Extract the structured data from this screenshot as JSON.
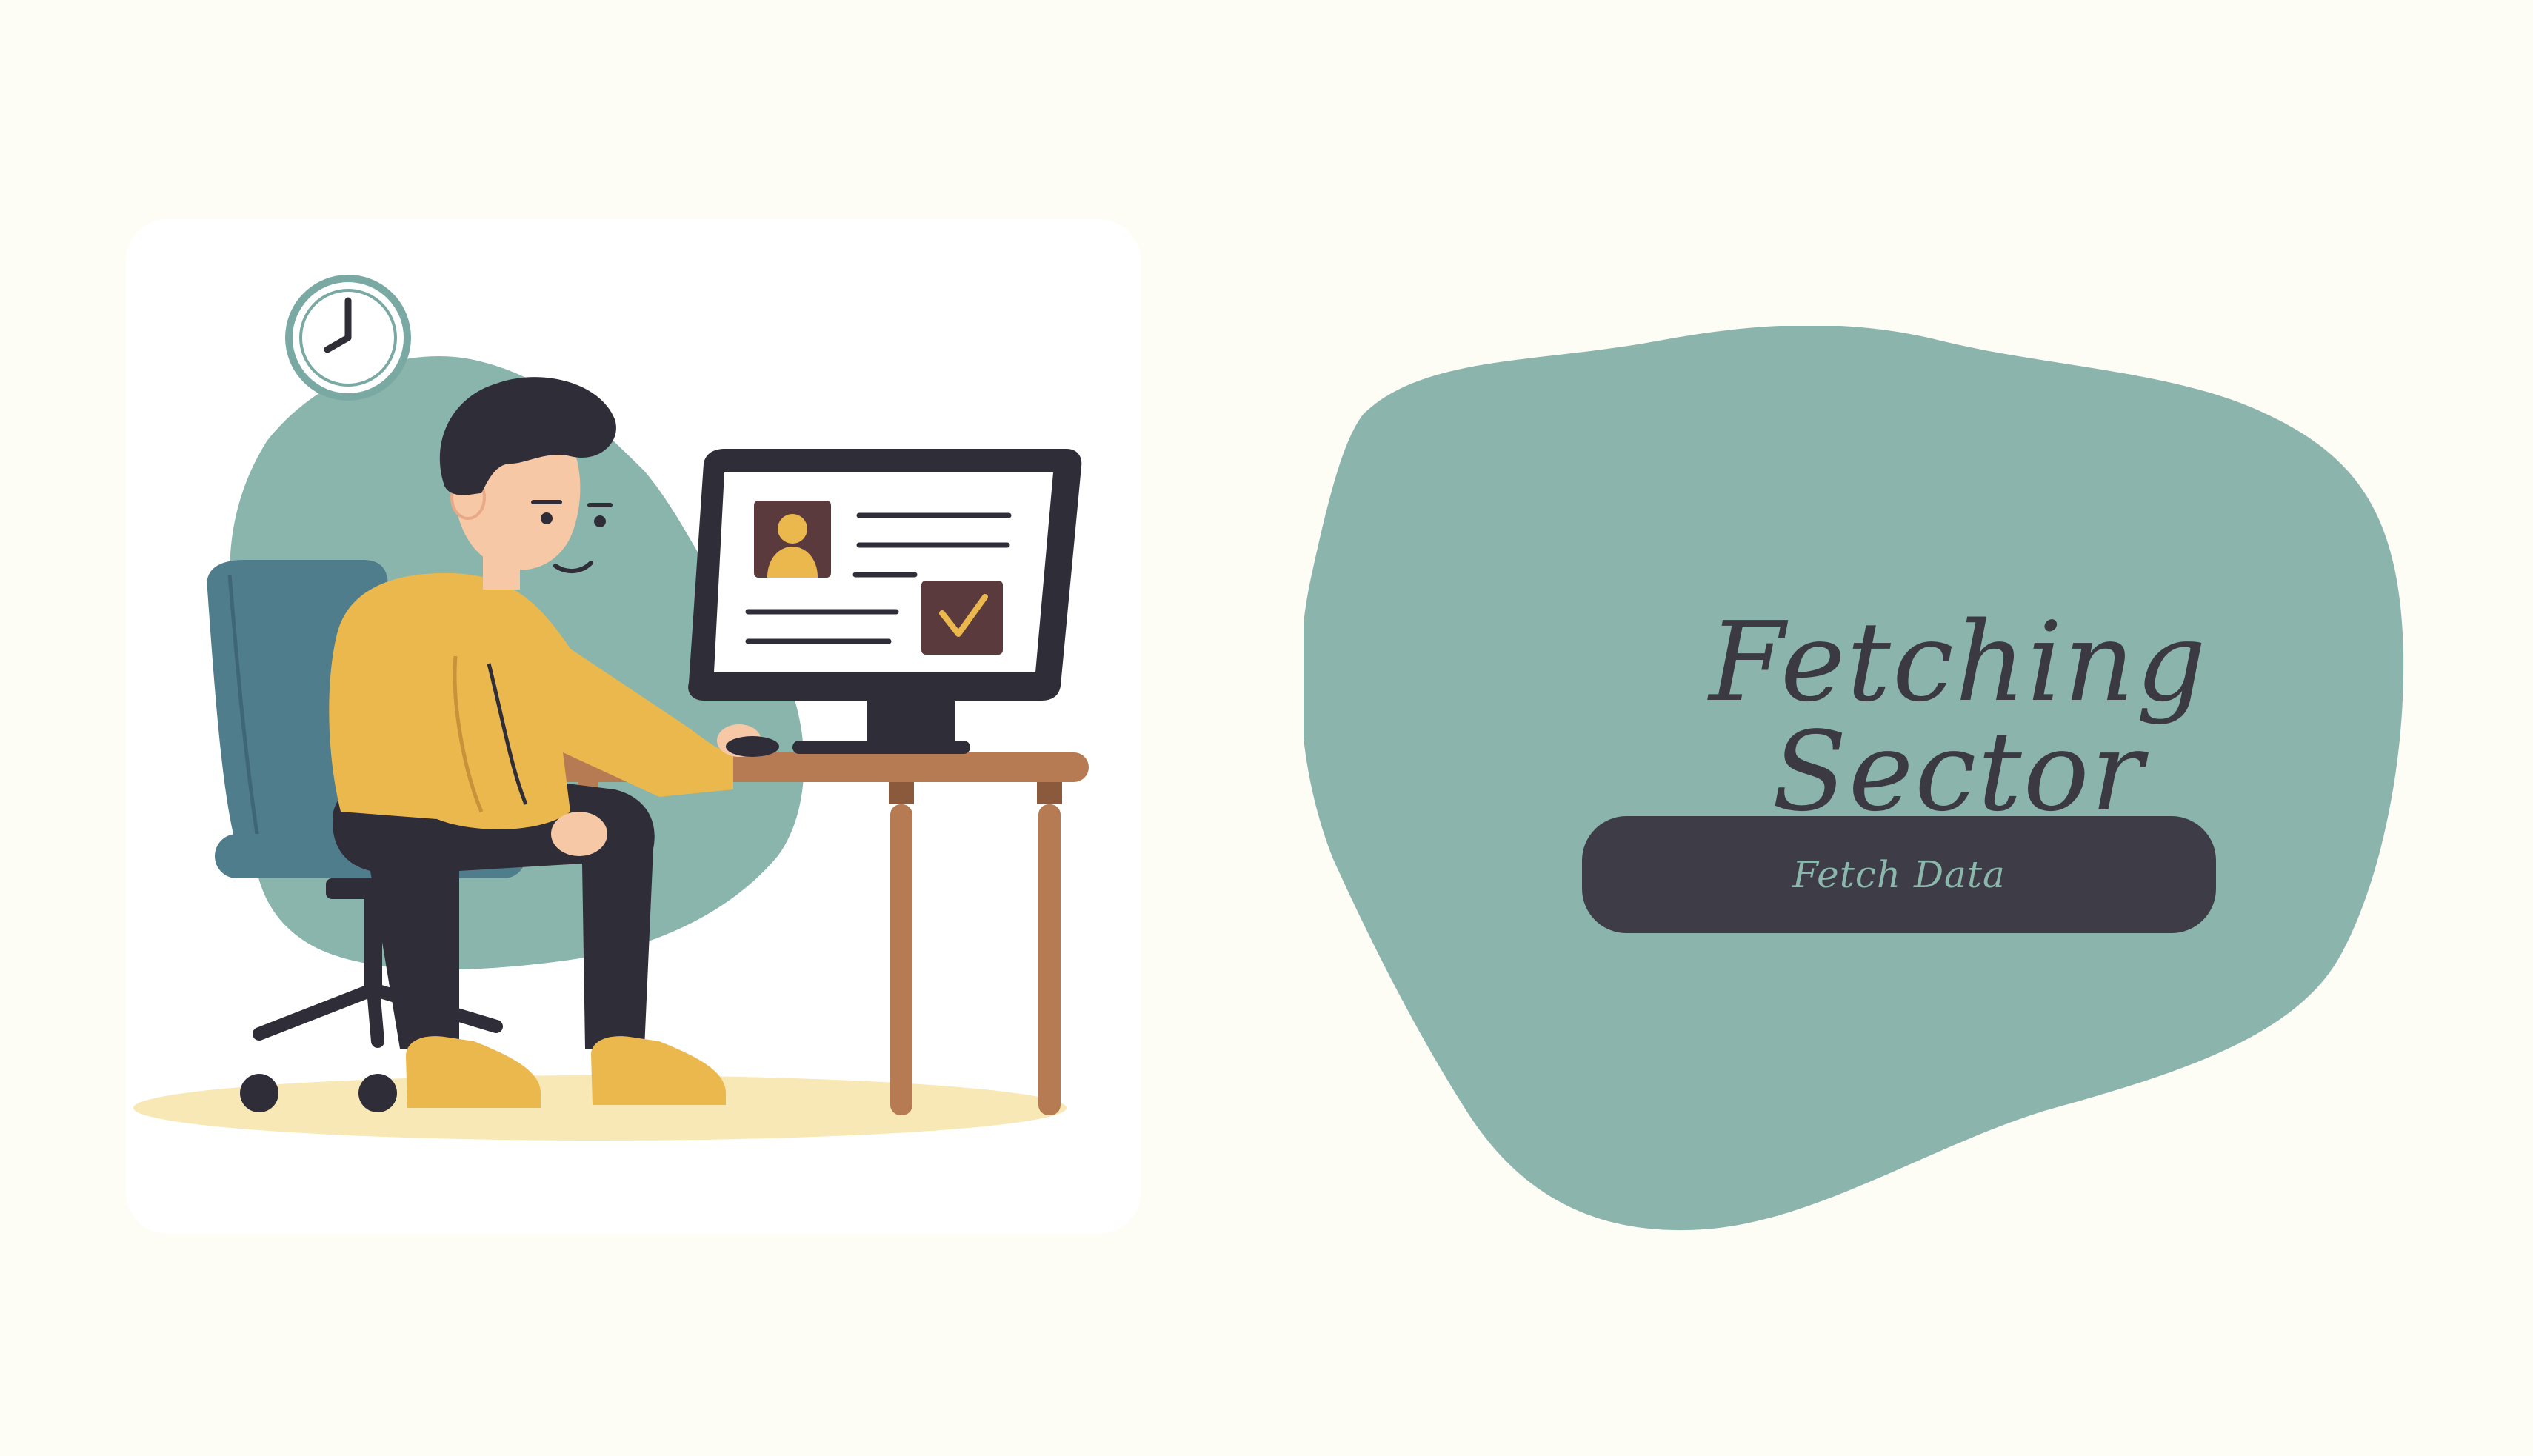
{
  "panel": {
    "title": "Fetching Sector",
    "button_label": "Fetch Data"
  },
  "illustration": {
    "subject": "person-working-at-computer",
    "icons": [
      "clock-icon",
      "user-profile-icon",
      "checkmark-icon"
    ]
  },
  "colors": {
    "page_background": "#fdfcf5",
    "card_background": "#ffffff",
    "accent_teal": "#8bb7ad",
    "dark": "#3d3c47",
    "sweater_yellow": "#ebb84e",
    "chair_blue": "#4f7d8c",
    "desk_brown": "#b67b52"
  }
}
